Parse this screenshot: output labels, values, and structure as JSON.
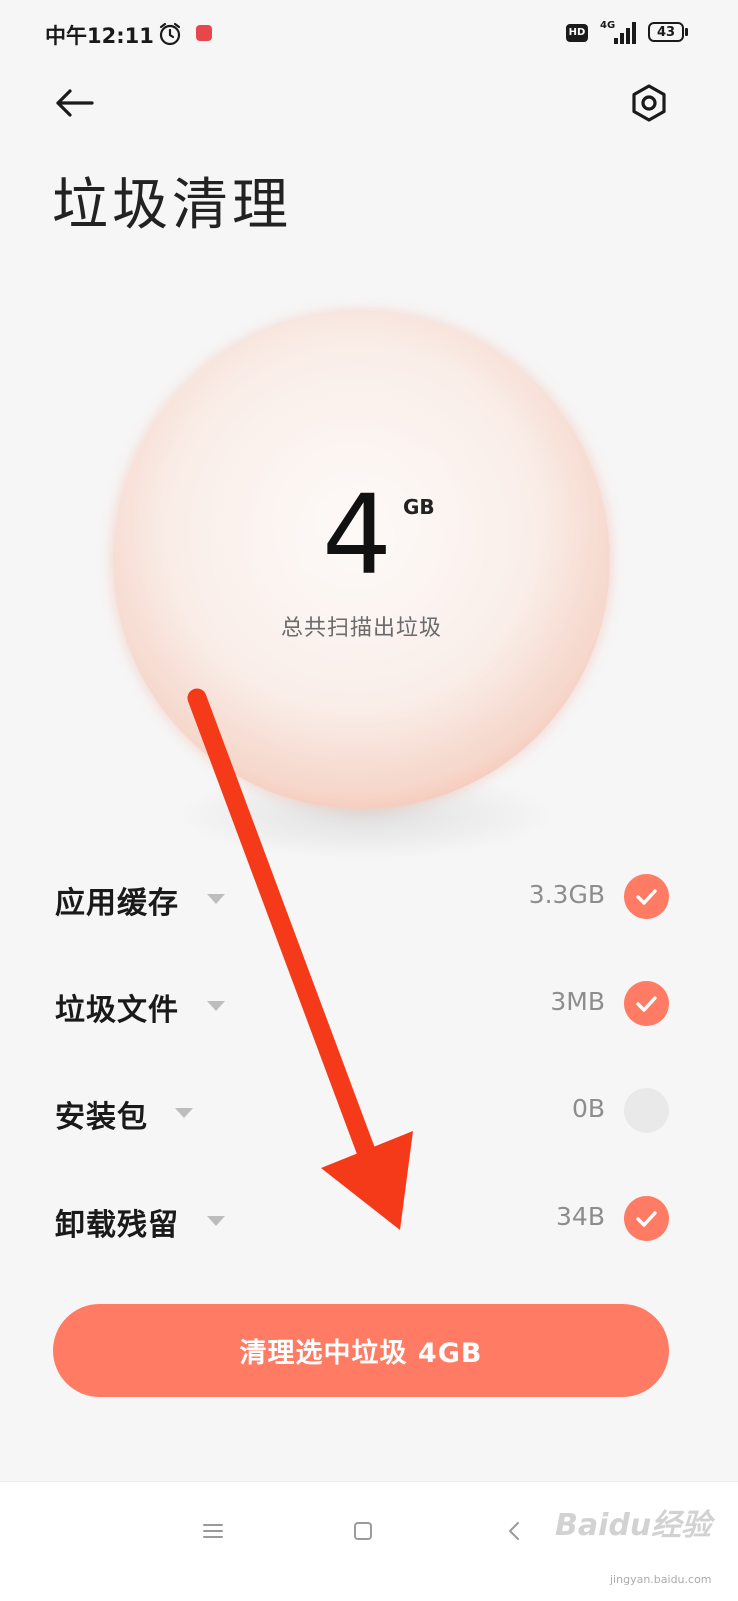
{
  "status_bar": {
    "time": "中午12:11",
    "hd_badge": "HD",
    "network": "4G",
    "battery": "43",
    "icons": [
      "alarm-icon",
      "app-notification-icon",
      "hd-icon",
      "signal-icon",
      "battery-icon"
    ]
  },
  "header": {
    "back_icon": "arrow-left-icon",
    "settings_icon": "gear-icon",
    "title": "垃圾清理"
  },
  "summary": {
    "total_value": "4",
    "total_unit": "GB",
    "caption": "总共扫描出垃圾"
  },
  "categories": [
    {
      "label": "应用缓存",
      "size": "3.3GB",
      "checked": true
    },
    {
      "label": "垃圾文件",
      "size": "3MB",
      "checked": true
    },
    {
      "label": "安装包",
      "size": "0B",
      "checked": false
    },
    {
      "label": "卸载残留",
      "size": "34B",
      "checked": true
    }
  ],
  "action": {
    "clean_label": "清理选中垃圾 4GB"
  },
  "nav_bar": {
    "icons": [
      "menu-icon",
      "home-icon",
      "back-icon"
    ]
  },
  "watermark": {
    "text": "Baidu经验",
    "sub": "jingyan.baidu.com"
  },
  "colors": {
    "accent": "#ff7b64",
    "arrow": "#f53a1a",
    "background": "#f6f6f6"
  }
}
